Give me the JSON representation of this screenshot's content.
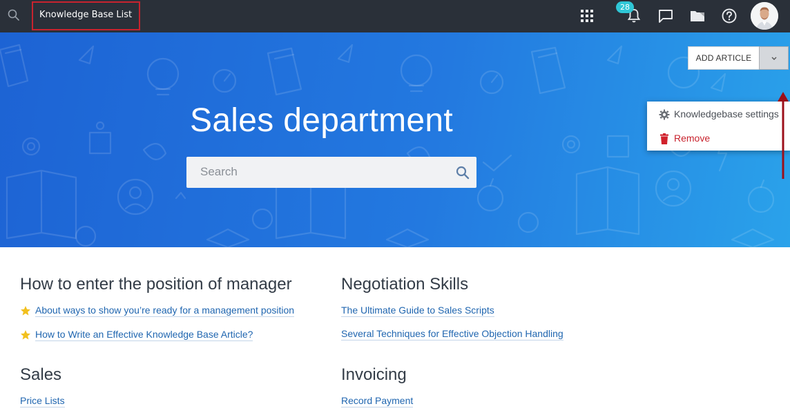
{
  "topbar": {
    "title": "Knowledge Base List",
    "notification_count": "28",
    "icons": [
      "search-icon",
      "apps-grid-icon",
      "bell-icon",
      "chat-icon",
      "folder-icon",
      "help-icon"
    ]
  },
  "hero": {
    "title": "Sales department",
    "search_placeholder": "Search",
    "add_article_label": "ADD ARTICLE",
    "menu": {
      "settings_label": "Knowledgebase settings",
      "remove_label": "Remove"
    }
  },
  "colors": {
    "topbar": "#2a3039",
    "hero_start": "#1d63d4",
    "hero_end": "#2aa2ea",
    "link": "#2066b0",
    "remove": "#c8232e",
    "badge": "#2fc6d6",
    "star": "#f2c01e"
  },
  "sections": [
    {
      "title": "How to enter the position of manager",
      "links": [
        {
          "text": "About ways to show you’re ready for a management position",
          "starred": true
        },
        {
          "text": "How to Write an Effective Knowledge Base Article?",
          "starred": true
        }
      ]
    },
    {
      "title": "Negotiation Skills",
      "links": [
        {
          "text": "The Ultimate Guide to Sales Scripts",
          "starred": false
        },
        {
          "text": "Several Techniques for Effective Objection Handling",
          "starred": false
        }
      ]
    },
    {
      "title": "Sales",
      "links": [
        {
          "text": "Price Lists",
          "starred": false
        }
      ]
    },
    {
      "title": "Invoicing",
      "links": [
        {
          "text": "Record Payment",
          "starred": false
        }
      ]
    }
  ]
}
